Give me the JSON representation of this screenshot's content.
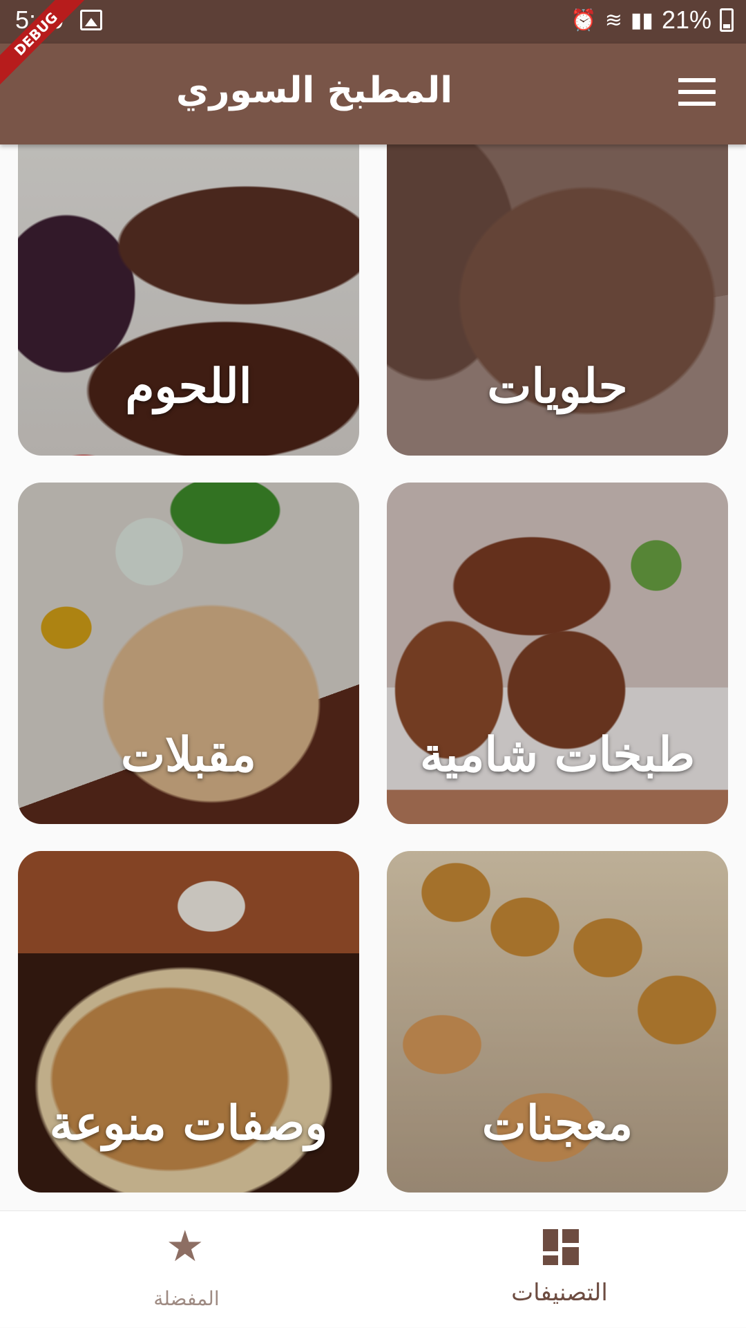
{
  "status_bar": {
    "time": "5:40",
    "battery": "21%"
  },
  "debug_banner": "DEBUG",
  "app_bar": {
    "title": "المطبخ السوري"
  },
  "categories": [
    {
      "label": "اللحوم"
    },
    {
      "label": "حلويات"
    },
    {
      "label": "مقبلات"
    },
    {
      "label": "طبخات شامية"
    },
    {
      "label": "وصفات منوعة"
    },
    {
      "label": "معجنات"
    }
  ],
  "bottom_nav": {
    "favorites": "المفضلة",
    "categories": "التصنيفات",
    "selected": "categories"
  },
  "colors": {
    "app_bar": "#795548",
    "status_bar": "#5d4037",
    "nav_active": "#6d4c41",
    "nav_inactive": "#9e8a82"
  }
}
